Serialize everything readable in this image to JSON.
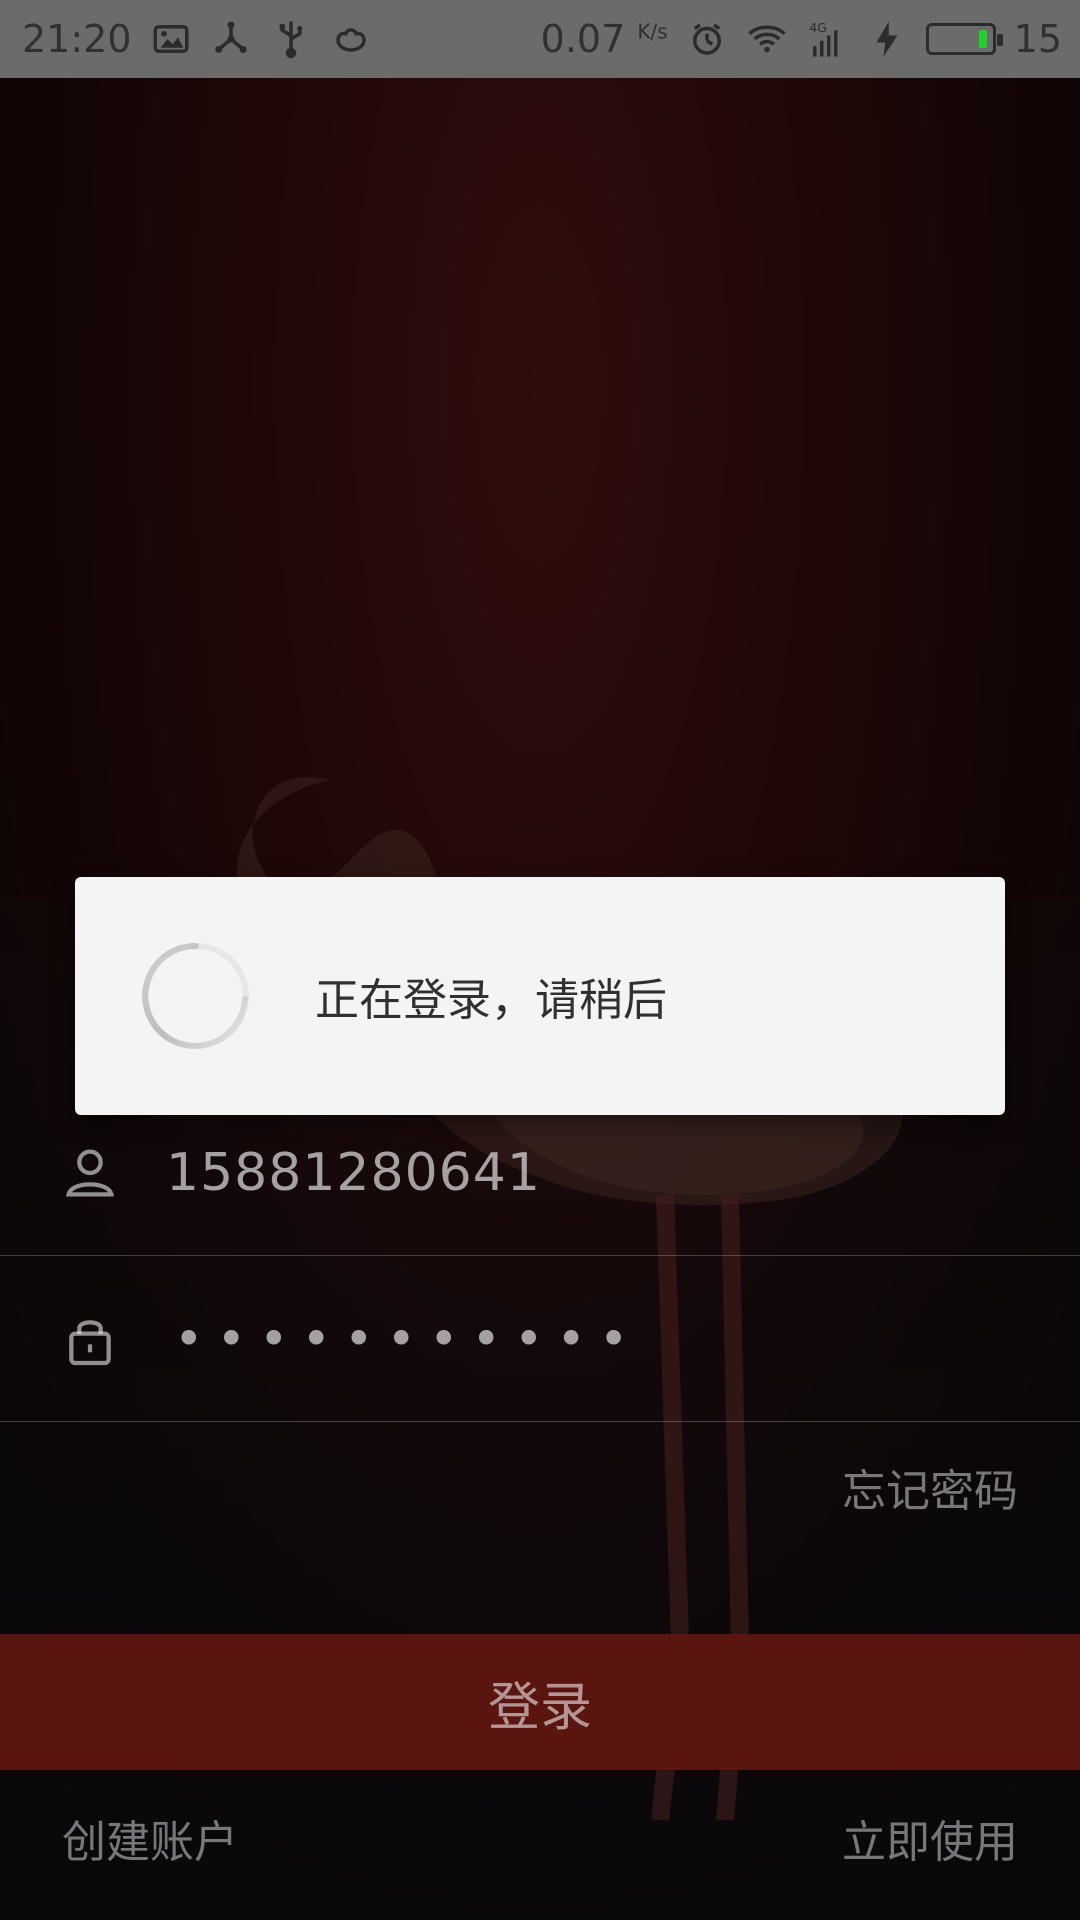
{
  "status_bar": {
    "time": "21:20",
    "speed": "0.07",
    "speed_unit": "K/s",
    "network": "4G",
    "battery_level": "15"
  },
  "login_form": {
    "username": "15881280641",
    "password_masked": "•••••••••••",
    "forgot_password": "忘记密码",
    "login_button": "登录",
    "create_account": "创建账户",
    "use_now": "立即使用"
  },
  "dialog": {
    "message": "正在登录，请稍后"
  },
  "colors": {
    "status_bar_bg": "#6b6b6b",
    "login_button_bg": "#5a1510",
    "dialog_bg": "#f4f4f4",
    "battery_level": "#1ed428"
  }
}
